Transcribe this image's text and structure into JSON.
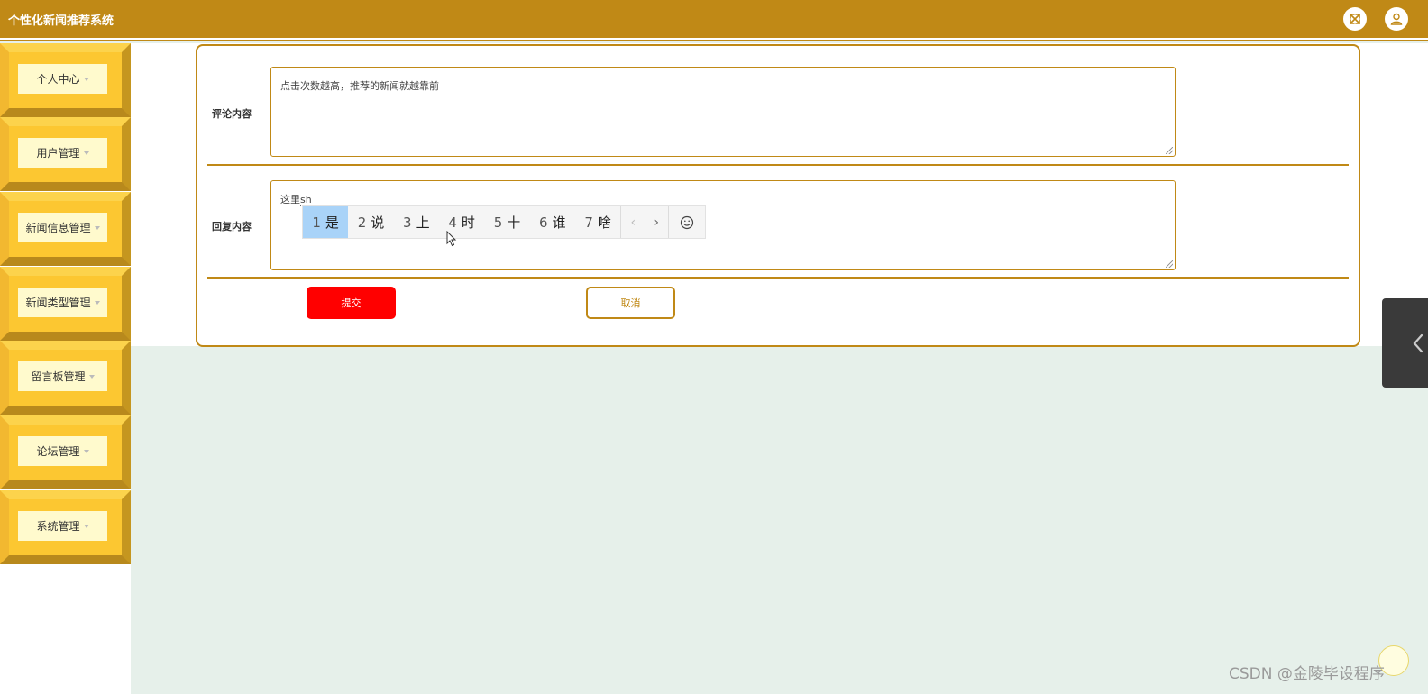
{
  "header": {
    "title": "个性化新闻推荐系统",
    "icons": [
      "fullscreen-icon",
      "user-icon"
    ],
    "color": "#c08916"
  },
  "sidebar": {
    "items": [
      {
        "label": "个人中心"
      },
      {
        "label": "用户管理"
      },
      {
        "label": "新闻信息管理"
      },
      {
        "label": "新闻类型管理"
      },
      {
        "label": "留言板管理"
      },
      {
        "label": "论坛管理"
      },
      {
        "label": "系统管理"
      }
    ]
  },
  "form": {
    "comment_label": "评论内容",
    "comment_value": "点击次数越高，推荐的新闻就越靠前",
    "reply_label": "回复内容",
    "reply_value_text": "这里",
    "reply_value_composing": "sh",
    "submit_label": "提交",
    "cancel_label": "取消"
  },
  "ime": {
    "candidates": [
      {
        "num": "1",
        "text": "是",
        "selected": true
      },
      {
        "num": "2",
        "text": "说"
      },
      {
        "num": "3",
        "text": "上"
      },
      {
        "num": "4",
        "text": "时"
      },
      {
        "num": "5",
        "text": "十"
      },
      {
        "num": "6",
        "text": "谁"
      },
      {
        "num": "7",
        "text": "啥"
      }
    ],
    "prev": "‹",
    "next": "›"
  },
  "watermark": "CSDN @金陵毕设程序"
}
